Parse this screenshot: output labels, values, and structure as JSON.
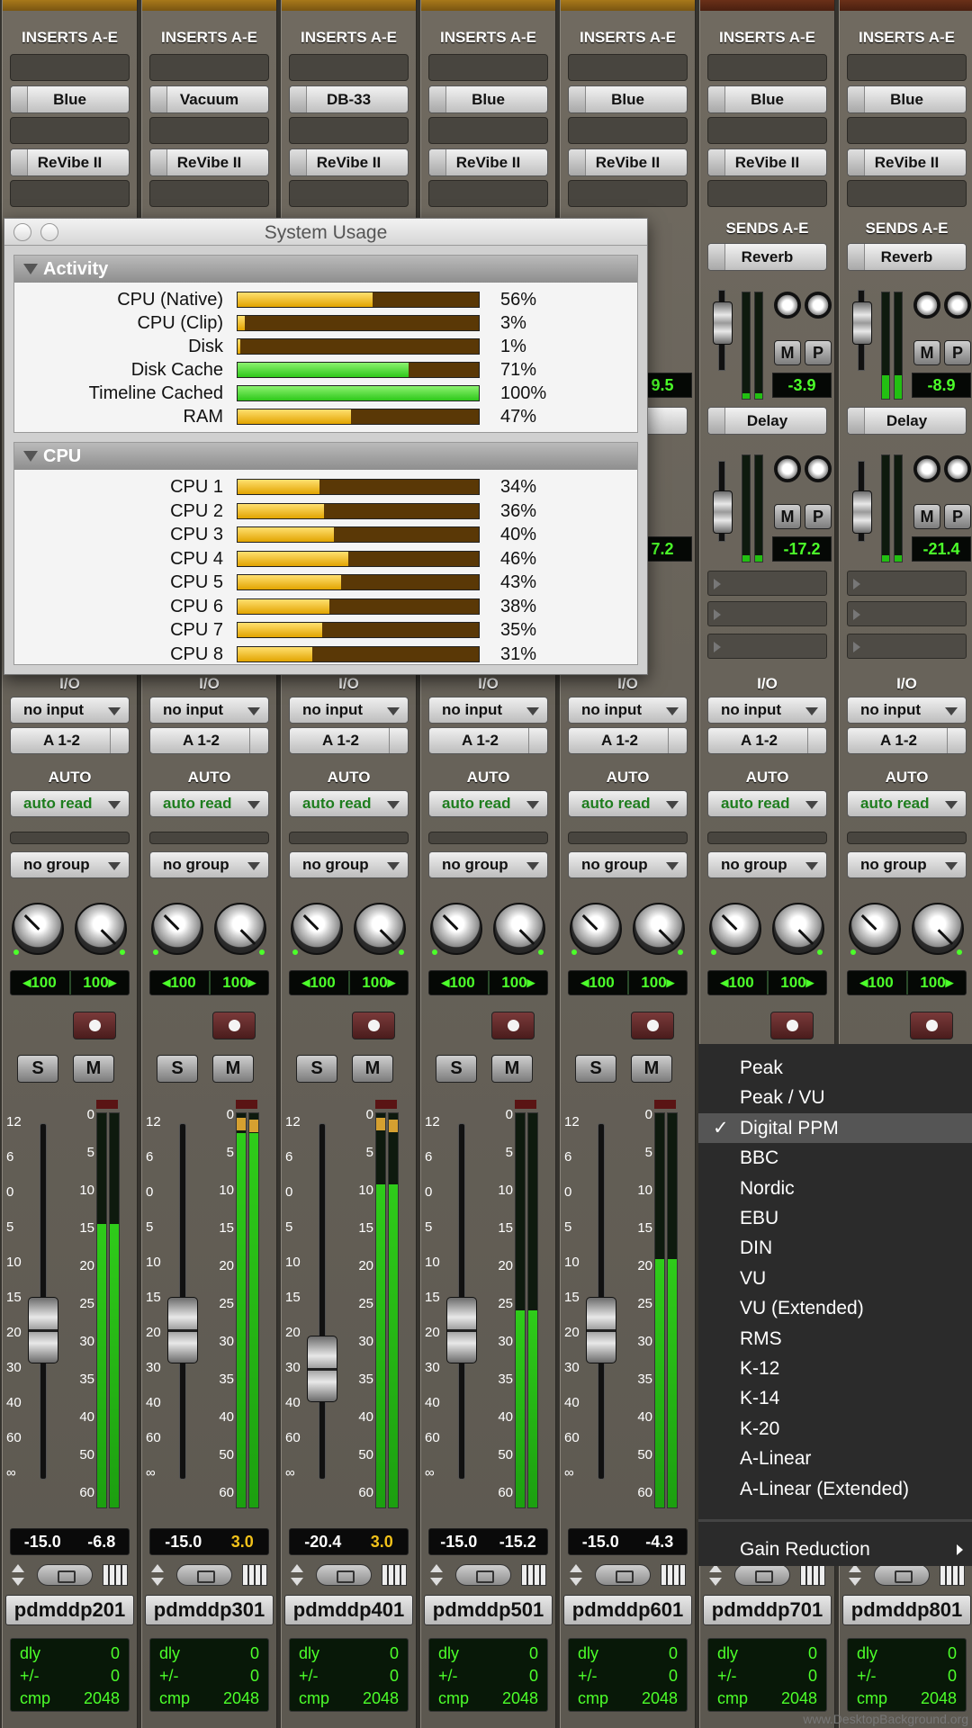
{
  "strips": [
    {
      "insert_label": "INSERTS A-E",
      "insert_a": "Blue",
      "insert_b": "ReVibe II",
      "io_label": "I/O",
      "input": "no input",
      "output": "A 1-2",
      "auto_label": "AUTO",
      "auto_mode": "auto read",
      "group": "no group",
      "pan_left": "◂100",
      "pan_right": "100▸",
      "solo": "S",
      "mute": "M",
      "vol": "-15.0",
      "peak": "-6.8",
      "peak_hot": false,
      "name": "pdmddp201",
      "dly_k": "dly",
      "dly_v": "0",
      "pm_k": "+/-",
      "pm_v": "0",
      "cmp_k": "cmp",
      "cmp_v": "2048",
      "level": 0.72,
      "fader": 0.58
    },
    {
      "insert_label": "INSERTS A-E",
      "insert_a": "Vacuum",
      "insert_b": "ReVibe II",
      "io_label": "I/O",
      "input": "no input",
      "output": "A 1-2",
      "auto_label": "AUTO",
      "auto_mode": "auto read",
      "group": "no group",
      "pan_left": "◂100",
      "pan_right": "100▸",
      "solo": "S",
      "mute": "M",
      "vol": "-15.0",
      "peak": "3.0",
      "peak_hot": true,
      "name": "pdmddp301",
      "dly_k": "dly",
      "dly_v": "0",
      "pm_k": "+/-",
      "pm_v": "0",
      "cmp_k": "cmp",
      "cmp_v": "2048",
      "level": 0.95,
      "fader": 0.58
    },
    {
      "insert_label": "INSERTS A-E",
      "insert_a": "DB-33",
      "insert_b": "ReVibe II",
      "io_label": "I/O",
      "input": "no input",
      "output": "A 1-2",
      "auto_label": "AUTO",
      "auto_mode": "auto read",
      "group": "no group",
      "pan_left": "◂100",
      "pan_right": "100▸",
      "solo": "S",
      "mute": "M",
      "vol": "-20.4",
      "peak": "3.0",
      "peak_hot": true,
      "name": "pdmddp401",
      "dly_k": "dly",
      "dly_v": "0",
      "pm_k": "+/-",
      "pm_v": "0",
      "cmp_k": "cmp",
      "cmp_v": "2048",
      "level": 0.82,
      "fader": 0.69
    },
    {
      "insert_label": "INSERTS A-E",
      "insert_a": "Blue",
      "insert_b": "ReVibe II",
      "io_label": "I/O",
      "input": "no input",
      "output": "A 1-2",
      "auto_label": "AUTO",
      "auto_mode": "auto read",
      "group": "no group",
      "pan_left": "◂100",
      "pan_right": "100▸",
      "solo": "S",
      "mute": "M",
      "vol": "-15.0",
      "peak": "-15.2",
      "peak_hot": false,
      "name": "pdmddp501",
      "dly_k": "dly",
      "dly_v": "0",
      "pm_k": "+/-",
      "pm_v": "0",
      "cmp_k": "cmp",
      "cmp_v": "2048",
      "level": 0.5,
      "fader": 0.58
    },
    {
      "insert_label": "INSERTS A-E",
      "insert_a": "Blue",
      "insert_b": "ReVibe II",
      "io_label": "I/O",
      "input": "no input",
      "output": "A 1-2",
      "auto_label": "AUTO",
      "auto_mode": "auto read",
      "group": "no group",
      "pan_left": "◂100",
      "pan_right": "100▸",
      "solo": "S",
      "mute": "M",
      "vol": "-15.0",
      "peak": "-4.3",
      "peak_hot": false,
      "name": "pdmddp601",
      "dly_k": "dly",
      "dly_v": "0",
      "pm_k": "+/-",
      "pm_v": "0",
      "cmp_k": "cmp",
      "cmp_v": "2048",
      "level": 0.63,
      "fader": 0.58
    },
    {
      "insert_label": "INSERTS A-E",
      "insert_a": "Blue",
      "insert_b": "ReVibe II",
      "sends_label": "SENDS A-E",
      "send_a": "Reverb",
      "send_a_val": "-3.9",
      "send_b": "Delay",
      "send_b_val": "-17.2",
      "io_label": "I/O",
      "input": "no input",
      "output": "A 1-2",
      "auto_label": "AUTO",
      "auto_mode": "auto read",
      "group": "no group",
      "pan_left": "◂100",
      "pan_right": "100▸",
      "name": "pdmddp701",
      "dly_k": "dly",
      "dly_v": "0",
      "pm_k": "+/-",
      "pm_v": "0",
      "cmp_k": "cmp",
      "cmp_v": "2048"
    },
    {
      "insert_label": "INSERTS A-E",
      "insert_a": "Blue",
      "insert_b": "ReVibe II",
      "sends_label": "SENDS A-E",
      "send_a": "Reverb",
      "send_a_val": "-8.9",
      "send_b": "Delay",
      "send_b_val": "-21.4",
      "io_label": "I/O",
      "input": "no input",
      "output": "A 1-2",
      "auto_label": "AUTO",
      "auto_mode": "auto read",
      "group": "no group",
      "pan_left": "◂100",
      "pan_right": "100▸",
      "name": "pdmddp801",
      "dly_k": "dly",
      "dly_v": "0",
      "pm_k": "+/-",
      "pm_v": "0",
      "cmp_k": "cmp",
      "cmp_v": "2048"
    }
  ],
  "partial_sends": {
    "val_a": "9.5",
    "val_b": "7.2",
    "btn_b": "y"
  },
  "scale_left": [
    "12",
    "6",
    "0",
    "5",
    "10",
    "15",
    "20",
    "30",
    "40",
    "60",
    "∞"
  ],
  "scale_right": [
    "0",
    "5",
    "10",
    "15",
    "20",
    "25",
    "30",
    "35",
    "40",
    "50",
    "60"
  ],
  "system_usage": {
    "title": "System Usage",
    "activity_label": "Activity",
    "activity": [
      {
        "label": "CPU (Native)",
        "pct": "56%",
        "value": 0.56,
        "color": "yellow"
      },
      {
        "label": "CPU (Clip)",
        "pct": "3%",
        "value": 0.03,
        "color": "yellow"
      },
      {
        "label": "Disk",
        "pct": "1%",
        "value": 0.01,
        "color": "yellow"
      },
      {
        "label": "Disk Cache",
        "pct": "71%",
        "value": 0.71,
        "color": "green"
      },
      {
        "label": "Timeline Cached",
        "pct": "100%",
        "value": 1.0,
        "color": "green"
      },
      {
        "label": "RAM",
        "pct": "47%",
        "value": 0.47,
        "color": "yellow"
      }
    ],
    "cpu_label": "CPU",
    "cpus": [
      {
        "label": "CPU 1",
        "pct": "34%",
        "value": 0.34
      },
      {
        "label": "CPU 2",
        "pct": "36%",
        "value": 0.36
      },
      {
        "label": "CPU 3",
        "pct": "40%",
        "value": 0.4
      },
      {
        "label": "CPU 4",
        "pct": "46%",
        "value": 0.46
      },
      {
        "label": "CPU 5",
        "pct": "43%",
        "value": 0.43
      },
      {
        "label": "CPU 6",
        "pct": "38%",
        "value": 0.38
      },
      {
        "label": "CPU 7",
        "pct": "35%",
        "value": 0.35
      },
      {
        "label": "CPU 8",
        "pct": "31%",
        "value": 0.31
      }
    ]
  },
  "meter_menu": {
    "items": [
      "Peak",
      "Peak / VU",
      "Digital PPM",
      "BBC",
      "Nordic",
      "EBU",
      "DIN",
      "VU",
      "VU (Extended)",
      "RMS",
      "K-12",
      "K-14",
      "K-20",
      "A-Linear",
      "A-Linear (Extended)"
    ],
    "selected": "Digital PPM",
    "submenu": "Gain Reduction"
  },
  "watermark": "www.DesktopBackground.org",
  "colors": {
    "meter_green": "#2fcc1a",
    "readout_green": "#4cff2a",
    "peak_yellow": "#f2c21a",
    "strip_cap": "#a8781a"
  }
}
